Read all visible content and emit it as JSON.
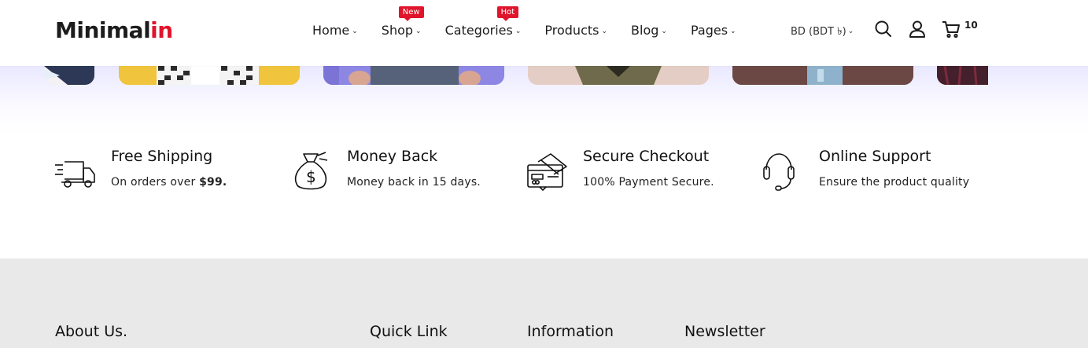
{
  "header": {
    "logo_main": "Minimal",
    "logo_accent": "in",
    "nav": [
      {
        "label": "Home"
      },
      {
        "label": "Shop",
        "badge": "New"
      },
      {
        "label": "Categories",
        "badge": "Hot"
      },
      {
        "label": "Products"
      },
      {
        "label": "Blog"
      },
      {
        "label": "Pages"
      }
    ],
    "chevron": "⌄",
    "currency": "BD (BDT ৳)",
    "cart_count": "10"
  },
  "features": [
    {
      "icon": "truck-icon",
      "title": "Free Shipping",
      "subtitle_prefix": "On orders over ",
      "subtitle_bold": "$99."
    },
    {
      "icon": "money-bag-icon",
      "title": "Money Back",
      "subtitle": "Money back in 15 days."
    },
    {
      "icon": "credit-card-icon",
      "title": "Secure Checkout",
      "subtitle": "100% Payment Secure."
    },
    {
      "icon": "headset-icon",
      "title": "Online Support",
      "subtitle": "Ensure the product quality"
    }
  ],
  "footer": {
    "about": "About Us.",
    "quick_link": "Quick Link",
    "information": "Information",
    "newsletter": "Newsletter"
  },
  "colors": {
    "accent": "#e0152b",
    "text": "#1c1c1c",
    "footer_bg": "#e9e9e9",
    "strip_tint": "#e9e8ff"
  }
}
